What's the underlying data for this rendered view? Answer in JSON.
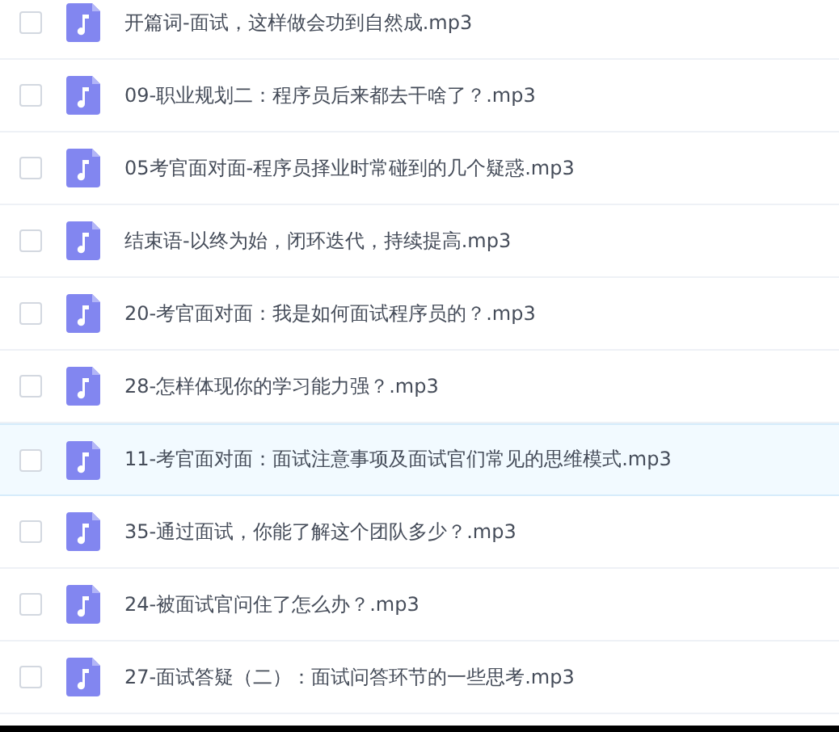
{
  "files": [
    {
      "name": "开篇词-面试，这样做会功到自然成.mp3",
      "checked": false,
      "selected": false
    },
    {
      "name": "09-职业规划二：程序员后来都去干啥了？.mp3",
      "checked": false,
      "selected": false
    },
    {
      "name": "05考官面对面-程序员择业时常碰到的几个疑惑.mp3",
      "checked": false,
      "selected": false
    },
    {
      "name": "结束语-以终为始，闭环迭代，持续提高.mp3",
      "checked": false,
      "selected": false
    },
    {
      "name": "20-考官面对面：我是如何面试程序员的？.mp3",
      "checked": false,
      "selected": false
    },
    {
      "name": "28-怎样体现你的学习能力强？.mp3",
      "checked": false,
      "selected": false
    },
    {
      "name": "11-考官面对面：面试注意事项及面试官们常见的思维模式.mp3",
      "checked": false,
      "selected": true
    },
    {
      "name": "35-通过面试，你能了解这个团队多少？.mp3",
      "checked": false,
      "selected": false
    },
    {
      "name": "24-被面试官问住了怎么办？.mp3",
      "checked": false,
      "selected": false
    },
    {
      "name": "27-面试答疑（二）：面试问答环节的一些思考.mp3",
      "checked": false,
      "selected": false
    }
  ]
}
